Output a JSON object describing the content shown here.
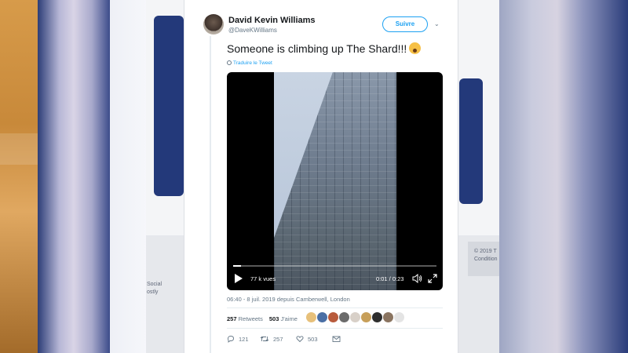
{
  "tweet": {
    "author_name": "David Kevin Williams",
    "author_handle": "@DaveKWilliams",
    "follow_label": "Suivre",
    "text": "Someone is climbing up The Shard!!!",
    "emoji": "exploding-head",
    "translate_label": "Traduire le Tweet",
    "meta": "06:40 - 8 juil. 2019 depuis Camberwell, London",
    "stats": {
      "retweets_count": "257",
      "retweets_label": "Retweets",
      "likes_count": "503",
      "likes_label": "J'aime"
    },
    "actions": {
      "reply_count": "121",
      "retweet_count": "257",
      "like_count": "503"
    }
  },
  "video": {
    "views": "77 k vues",
    "time": "0:01 / 0:23",
    "progress": 0.04
  },
  "background": {
    "footer_left": "Social\nostly",
    "footer_right": "© 2019 T\nCondition"
  },
  "likers": [
    {
      "color": "#e7c07a"
    },
    {
      "color": "#4a6fa5"
    },
    {
      "color": "#b85b3c"
    },
    {
      "color": "#6b6b6b"
    },
    {
      "color": "#d8d0c8"
    },
    {
      "color": "#c79f59"
    },
    {
      "color": "#2e2e2e"
    },
    {
      "color": "#8a7460"
    },
    {
      "color": "#e4e4e4"
    }
  ],
  "colors": {
    "accent": "#1da1f2",
    "text_primary": "#14171a",
    "text_secondary": "#657786"
  }
}
